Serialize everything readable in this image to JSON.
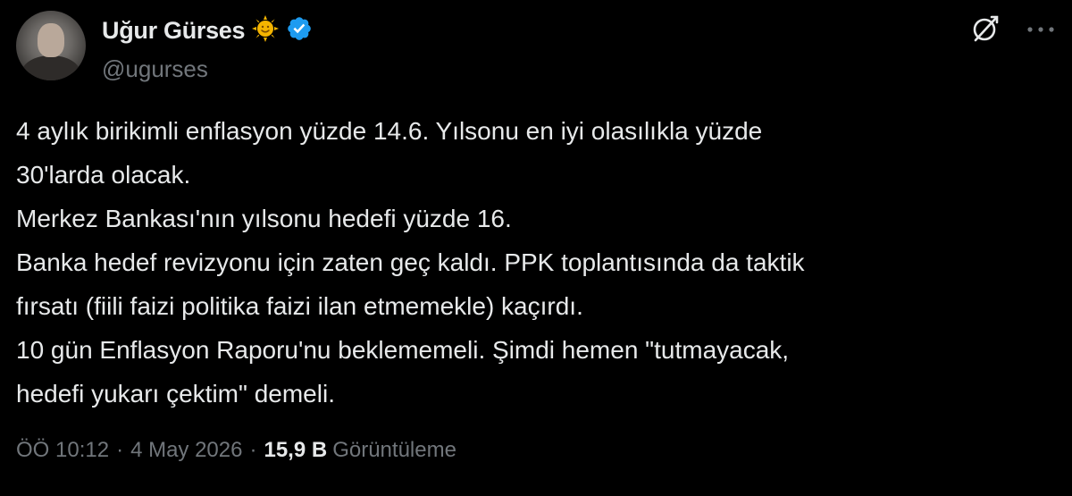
{
  "author": {
    "display_name": "Uğur Gürses",
    "handle": "@ugurses",
    "avatar_icon": "person-avatar",
    "badge_icons": [
      "sun-emoji-icon",
      "verified-badge-icon"
    ],
    "badge_color": "#1d9bf0"
  },
  "header_actions": {
    "grok_icon": "grok-icon",
    "more_icon": "more-options-icon"
  },
  "tweet": {
    "text": "4 aylık birikimli enflasyon yüzde 14.6. Yılsonu en iyi olasılıkla yüzde\n30'larda olacak.\nMerkez Bankası'nın yılsonu hedefi yüzde 16.\nBanka hedef revizyonu için zaten geç kaldı. PPK toplantısında da taktik\nfırsatı (fiili faizi politika faizi ilan etmemekle) kaçırdı.\n10 gün Enflasyon Raporu'nu beklememeli. Şimdi hemen \"tutmayacak,\nhedefi yukarı çektim\" demeli."
  },
  "meta": {
    "time": "ÖÖ 10:12",
    "separator": "·",
    "date": "4 May 2026",
    "views_count": "15,9 B",
    "views_label": "Görüntüleme"
  },
  "colors": {
    "background": "#000000",
    "text_primary": "#e7e9ea",
    "text_secondary": "#71767b",
    "accent": "#1d9bf0"
  }
}
